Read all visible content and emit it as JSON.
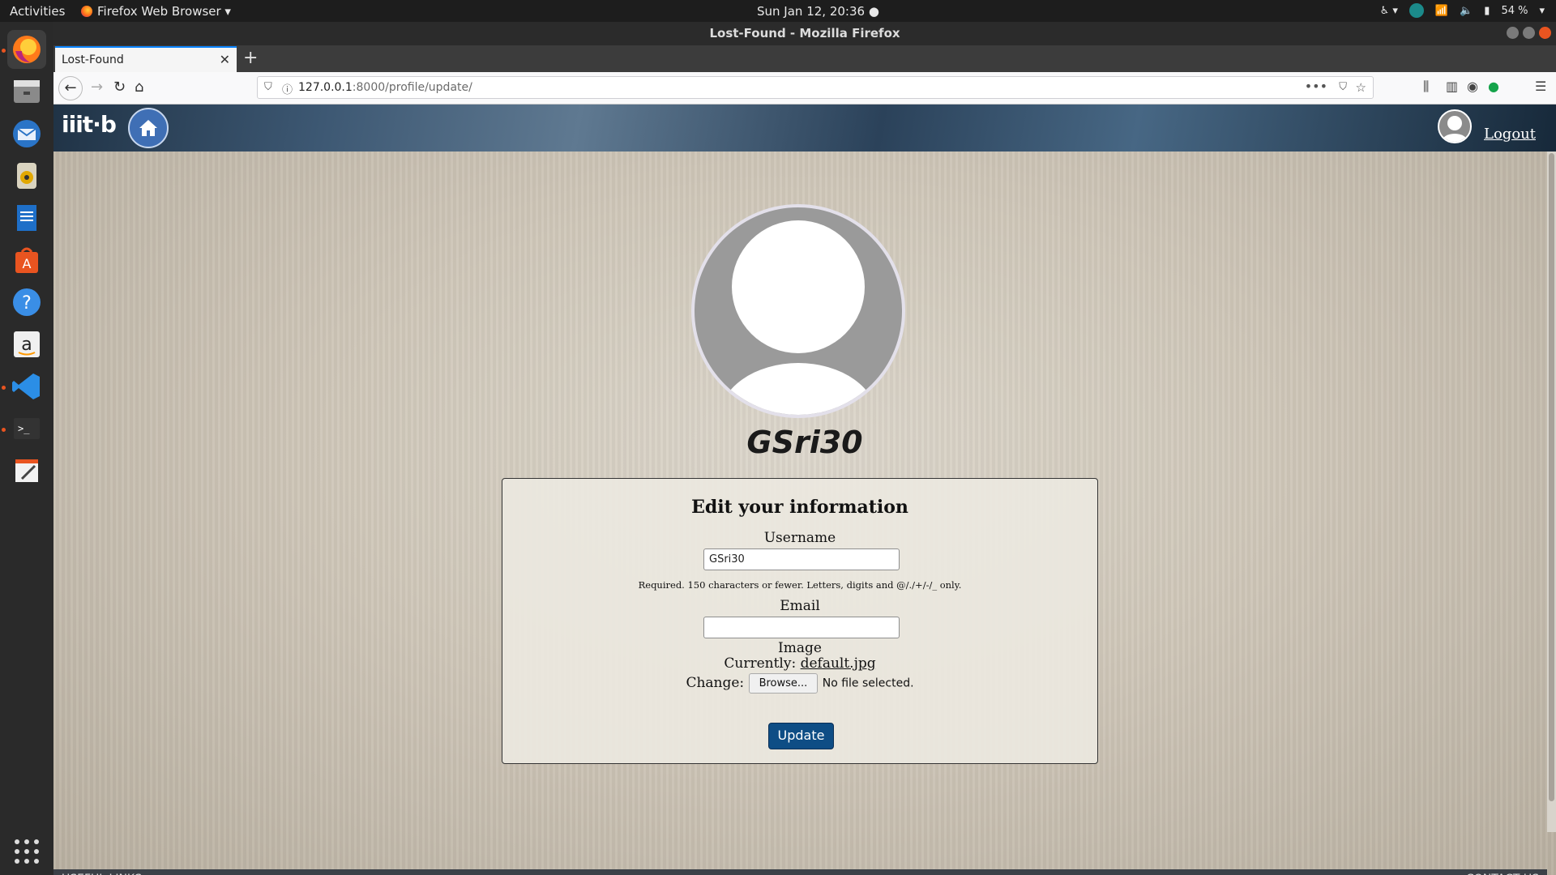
{
  "system": {
    "activities": "Activities",
    "app_menu": "Firefox Web Browser ▾",
    "clock": "Sun Jan 12, 20:36 ●",
    "battery": "54 %"
  },
  "window": {
    "title": "Lost-Found - Mozilla Firefox"
  },
  "browser": {
    "tab_title": "Lost-Found",
    "url_host": "127.0.0.1",
    "url_path": ":8000/profile/update/"
  },
  "site": {
    "logo_text": "iiit·b",
    "logout_label": "Logout",
    "footer_left": "USEFUL LINKS",
    "footer_right": "CONTACT US"
  },
  "profile": {
    "username": "GSri30"
  },
  "form": {
    "title": "Edit your information",
    "username_label": "Username",
    "username_value": "GSri30",
    "username_help": "Required. 150 characters or fewer. Letters, digits and @/./+/-/_ only.",
    "email_label": "Email",
    "email_value": "",
    "image_label": "Image",
    "currently_label": "Currently:",
    "current_file": "default.jpg",
    "change_label": "Change:",
    "browse_label": "Browse...",
    "no_file_label": "No file selected.",
    "submit_label": "Update"
  },
  "colors": {
    "accent": "#0e4d85",
    "ubuntu_orange": "#e95420"
  }
}
